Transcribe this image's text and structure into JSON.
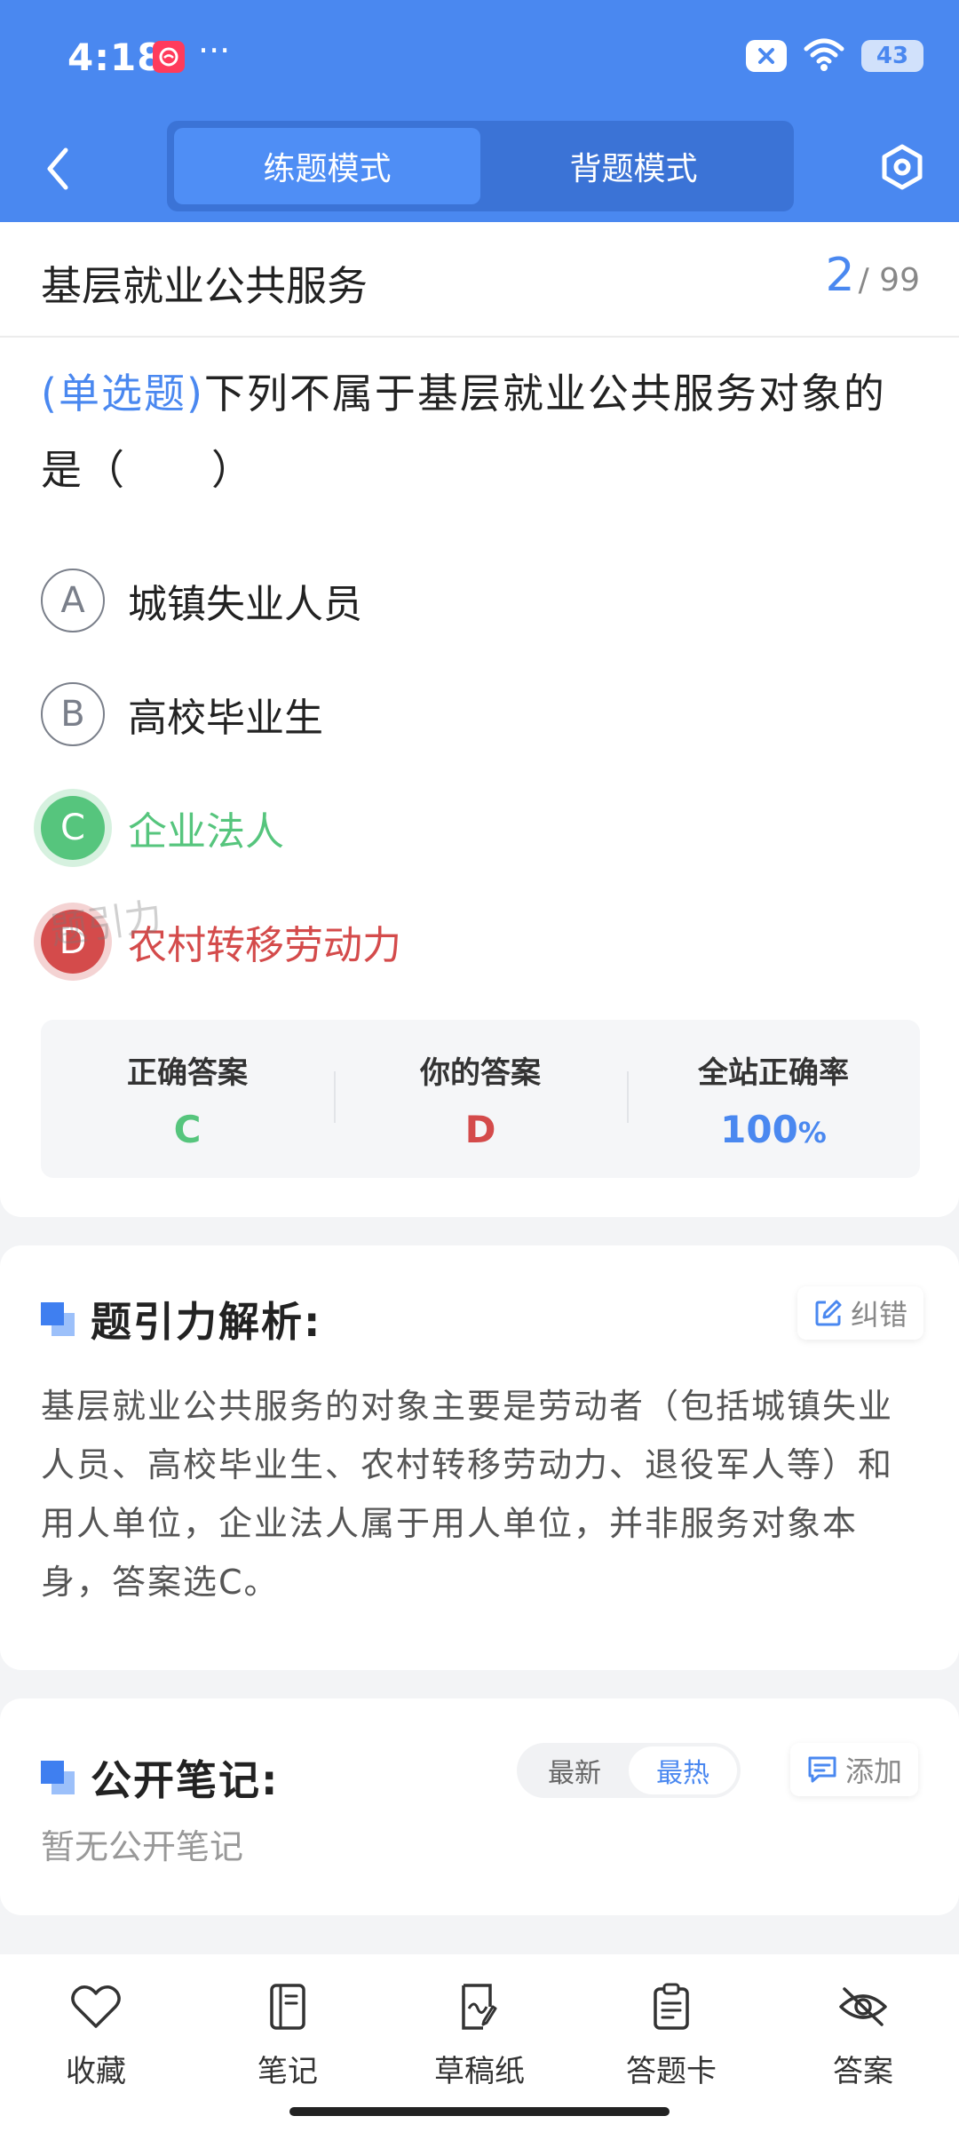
{
  "status_bar": {
    "time": "4:18",
    "dots": "···",
    "close_icon": "close-pill-icon",
    "battery": "43"
  },
  "nav": {
    "back_icon": "chevron-left-icon",
    "tabs": [
      {
        "label": "练题模式",
        "active": true
      },
      {
        "label": "背题模式",
        "active": false
      }
    ],
    "settings_icon": "hexagon-settings-icon"
  },
  "question": {
    "chapter": "基层就业公共服务",
    "current": "2",
    "total": "/ 99",
    "type": "(单选题)",
    "stem": "下列不属于基层就业公共服务对象的是（　　）",
    "options": [
      {
        "key": "A",
        "text": "城镇失业人员",
        "state": "normal"
      },
      {
        "key": "B",
        "text": "高校毕业生",
        "state": "normal"
      },
      {
        "key": "C",
        "text": "企业法人",
        "state": "correct"
      },
      {
        "key": "D",
        "text": "农村转移劳动力",
        "state": "wrong"
      }
    ]
  },
  "stats": {
    "correct_label": "正确答案",
    "correct_value": "C",
    "yours_label": "你的答案",
    "yours_value": "D",
    "rate_label": "全站正确率",
    "rate_value": "100",
    "rate_unit": "%",
    "watermark": "题引力"
  },
  "analysis": {
    "title": "题引力解析:",
    "report_button": "纠错",
    "text": "基层就业公共服务的对象主要是劳动者（包括城镇失业人员、高校毕业生、农村转移劳动力、退役军人等）和用人单位，企业法人属于用人单位，并非服务对象本身，答案选C。"
  },
  "notes": {
    "title": "公开笔记:",
    "sort_newest": "最新",
    "sort_hottest": "最热",
    "add_button": "添加",
    "empty": "暂无公开笔记"
  },
  "bottom_bar": [
    {
      "label": "收藏",
      "icon": "heart-icon"
    },
    {
      "label": "笔记",
      "icon": "notebook-icon"
    },
    {
      "label": "草稿纸",
      "icon": "draft-paper-icon"
    },
    {
      "label": "答题卡",
      "icon": "answer-sheet-icon"
    },
    {
      "label": "答案",
      "icon": "eye-off-icon"
    }
  ],
  "colors": {
    "primary": "#4a88f0",
    "correct": "#56c57d",
    "wrong": "#d44b4b"
  }
}
